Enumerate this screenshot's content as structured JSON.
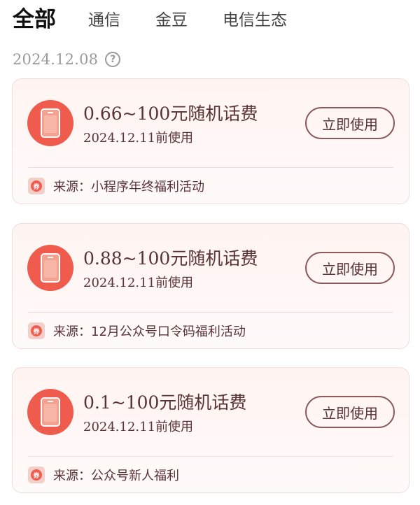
{
  "tabs": [
    {
      "label": "全部",
      "active": true
    },
    {
      "label": "通信",
      "active": false
    },
    {
      "label": "金豆",
      "active": false
    },
    {
      "label": "电信生态",
      "active": false
    }
  ],
  "date_group": {
    "date": "2024.12.08",
    "help_icon": "?"
  },
  "coupons": [
    {
      "title": "0.66~100元随机话费",
      "expiry": "2024.12.11前使用",
      "button": "立即使用",
      "source": "来源：小程序年终福利活动",
      "source_icon_glyph": "券"
    },
    {
      "title": "0.88~100元随机话费",
      "expiry": "2024.12.11前使用",
      "button": "立即使用",
      "source": "来源：12月公众号口令码福利活动",
      "source_icon_glyph": "券"
    },
    {
      "title": "0.1~100元随机话费",
      "expiry": "2024.12.11前使用",
      "button": "立即使用",
      "source": "来源：公众号新人福利",
      "source_icon_glyph": "券"
    }
  ],
  "colors": {
    "accent": "#ef5b4d",
    "text_primary": "#5a3236",
    "card_bg": "#fff4f1"
  }
}
